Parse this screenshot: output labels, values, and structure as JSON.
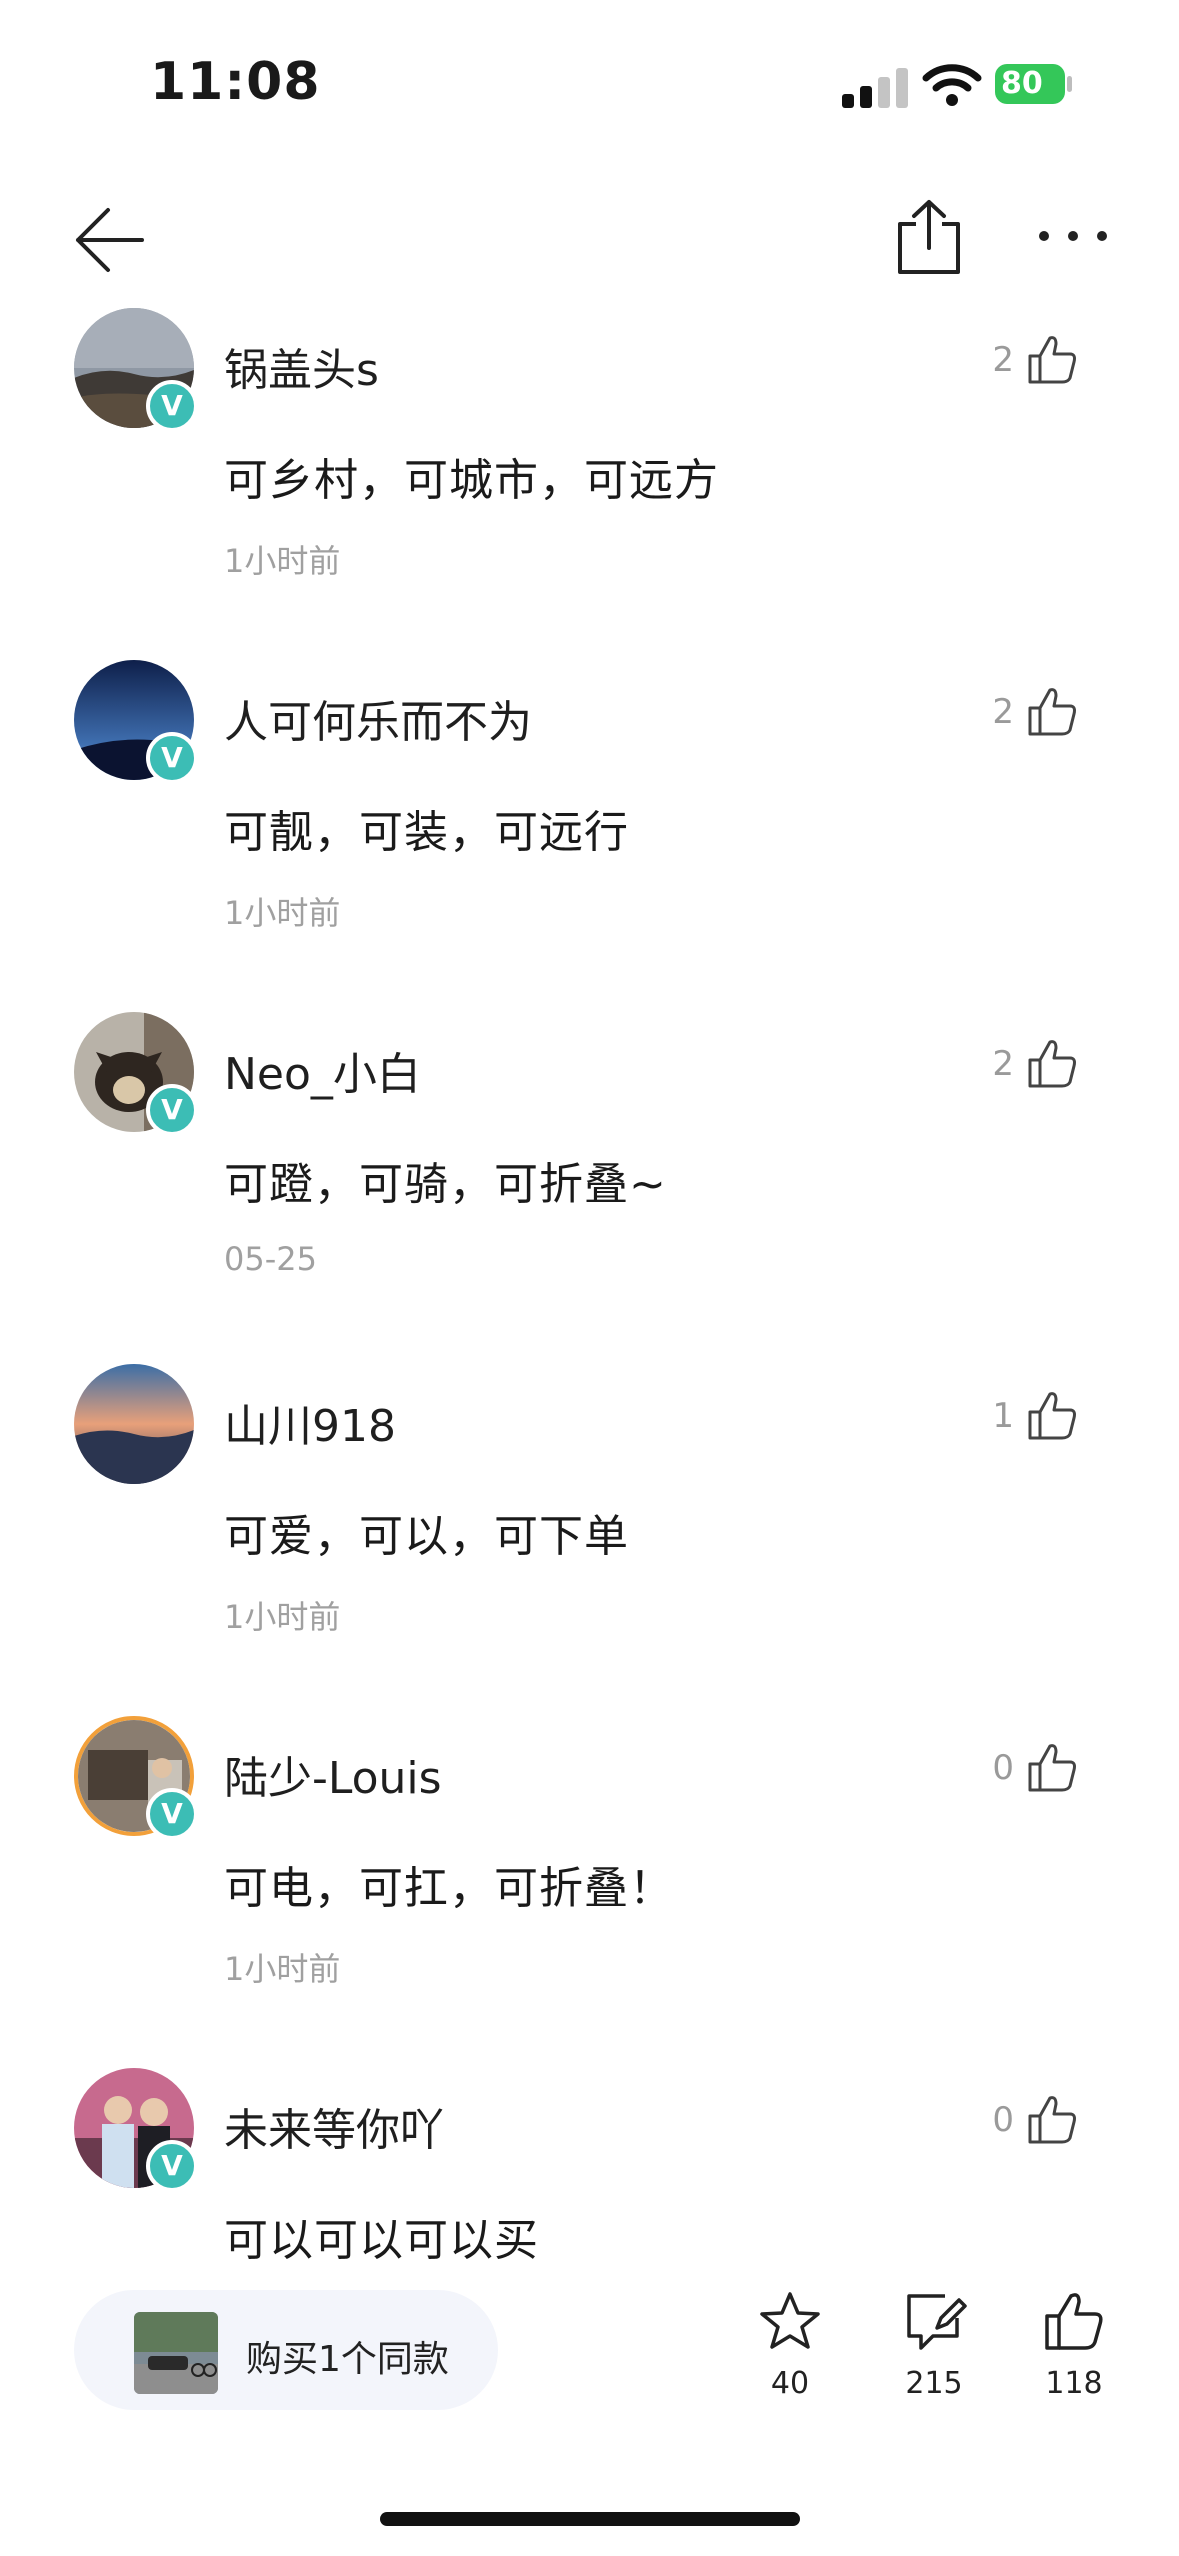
{
  "status_bar": {
    "time": "11:08",
    "battery": "80"
  },
  "comments": [
    {
      "username": "锅盖头s",
      "text": "可乡村，可城市，可远方",
      "time": "1小时前",
      "likes": "2",
      "badge": "V"
    },
    {
      "username": "人可何乐而不为",
      "text": "可靓，可装，可远行",
      "time": "1小时前",
      "likes": "2",
      "badge": "V"
    },
    {
      "username": "Neo_小白",
      "text": "可蹬，可骑，可折叠~",
      "time": "05-25",
      "likes": "2",
      "badge": "V"
    },
    {
      "username": "山川918",
      "text": "可爱，可以，可下单",
      "time": "1小时前",
      "likes": "1"
    },
    {
      "username": "陆少-Louis",
      "text": "可电，可扛，可折叠！",
      "time": "1小时前",
      "likes": "0",
      "badge": "V"
    },
    {
      "username": "未来等你吖",
      "text": "可以可以可以买",
      "time": "",
      "likes": "0",
      "badge": "V"
    }
  ],
  "bottom_bar": {
    "buy_label": "购买1个同款",
    "favorite_count": "40",
    "comment_count": "215",
    "like_count": "118"
  },
  "colors": {
    "badge": "#3cbdb5",
    "battery": "#34c759",
    "pill_bg": "#f3f5fb"
  }
}
